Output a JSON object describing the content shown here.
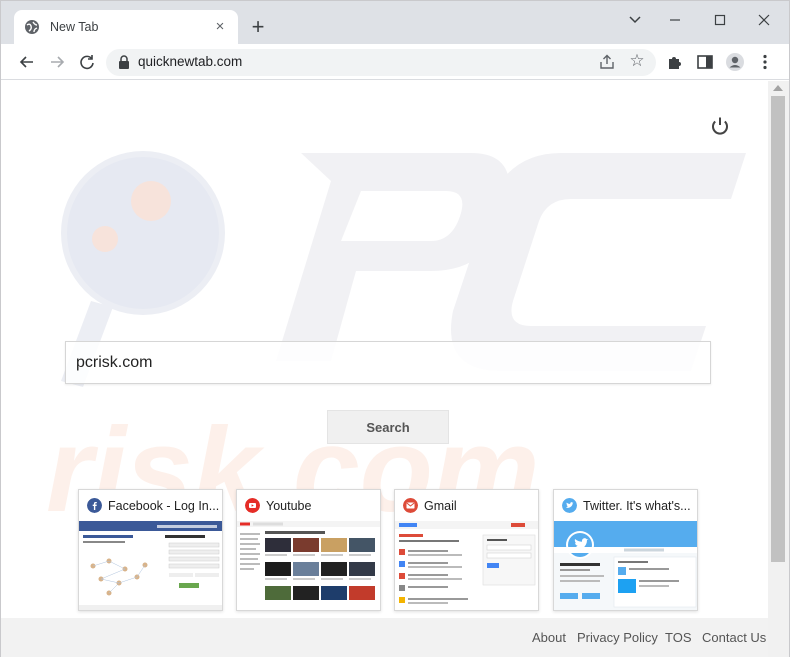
{
  "browser": {
    "tab_title": "New Tab",
    "tab_close": "×",
    "new_tab": "+",
    "url": "quicknewtab.com",
    "star": "☆"
  },
  "search": {
    "value": "pcrisk.com",
    "button": "Search"
  },
  "tiles": [
    {
      "label": "Facebook - Log In...",
      "icon": "facebook-icon",
      "color": "#3b5998"
    },
    {
      "label": "Youtube",
      "icon": "youtube-icon",
      "color": "#e52d27"
    },
    {
      "label": "Gmail",
      "icon": "gmail-icon",
      "color": "#dd4b39"
    },
    {
      "label": "Twitter. It's what's...",
      "icon": "twitter-icon",
      "color": "#55acee"
    }
  ],
  "footer": {
    "about": "About",
    "privacy": "Privacy Policy",
    "tos": "TOS",
    "contact": "Contact Us"
  },
  "colors": {
    "titlebar": "#dee1e6",
    "footer_bg": "#f2f2f2"
  }
}
